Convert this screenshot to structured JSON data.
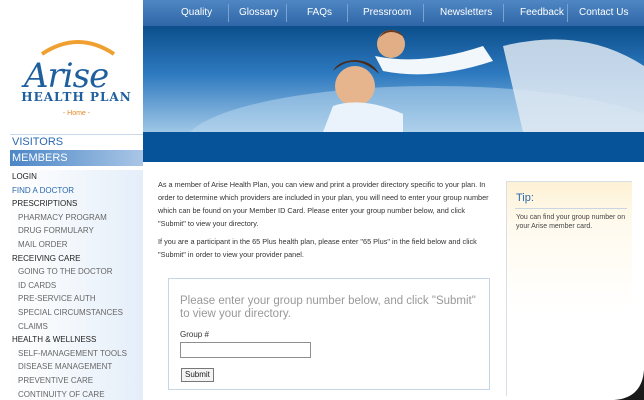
{
  "topnav": {
    "items": [
      "Quality",
      "Glossary",
      "FAQs",
      "Pressroom",
      "Newsletters",
      "Feedback",
      "Contact Us"
    ]
  },
  "logo": {
    "name": "Arise",
    "sub": "HEALTH PLAN",
    "home_link": "- Home -"
  },
  "sidebar": {
    "visitors": "VISITORS",
    "members": "MEMBERS",
    "items": [
      {
        "label": "LOGIN",
        "level": 0
      },
      {
        "label": "FIND A DOCTOR",
        "level": 0,
        "active": true
      },
      {
        "label": "PRESCRIPTIONS",
        "level": 0
      },
      {
        "label": "PHARMACY PROGRAM",
        "level": 1
      },
      {
        "label": "DRUG FORMULARY",
        "level": 1
      },
      {
        "label": "MAIL ORDER",
        "level": 1
      },
      {
        "label": "RECEIVING CARE",
        "level": 0
      },
      {
        "label": "GOING TO THE DOCTOR",
        "level": 1
      },
      {
        "label": "ID CARDS",
        "level": 1
      },
      {
        "label": "PRE-SERVICE AUTH",
        "level": 1
      },
      {
        "label": "SPECIAL CIRCUMSTANCES",
        "level": 1
      },
      {
        "label": "CLAIMS",
        "level": 1
      },
      {
        "label": "HEALTH & WELLNESS",
        "level": 0
      },
      {
        "label": "SELF-MANAGEMENT TOOLS",
        "level": 1
      },
      {
        "label": "DISEASE MANAGEMENT",
        "level": 1
      },
      {
        "label": "PREVENTIVE CARE",
        "level": 1
      },
      {
        "label": "CONTINUITY OF CARE",
        "level": 1
      }
    ]
  },
  "main": {
    "para1": "As a member of Arise Health Plan, you can view and print a provider directory specific to your plan. In order to determine which providers are included in your plan, you will need to enter your group number which can be found on your Member ID Card. Please enter your group number below, and click \"Submit\" to view your directory.",
    "para2": "If you are a participant in the 65 Plus health plan, please enter \"65 Plus\" in the field below and click \"Submit\" in order to view your provider panel."
  },
  "form": {
    "heading": "Please enter your group number below, and click \"Submit\" to view your directory.",
    "group_label": "Group #",
    "group_value": "",
    "submit_label": "Submit"
  },
  "tip": {
    "title": "Tip:",
    "text": "You can find your group number on your Arise member card."
  },
  "colors": {
    "brand_blue": "#2a68b0",
    "nav_blue": "#3a72b4",
    "accent_orange": "#e08a2a"
  }
}
